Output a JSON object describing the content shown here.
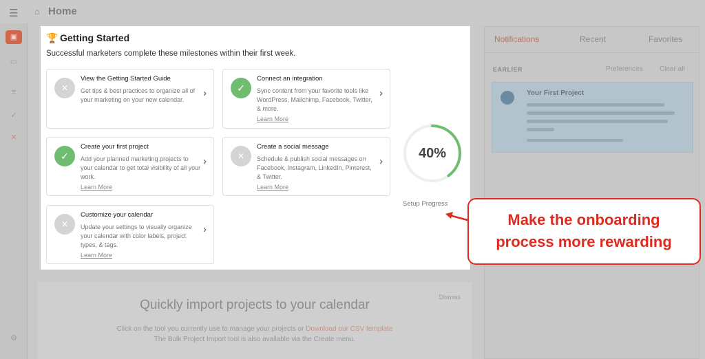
{
  "topbar": {
    "title": "Home"
  },
  "notifications": {
    "tabs": [
      "Notifications",
      "Recent",
      "Favorites"
    ],
    "section": "EARLIER",
    "preferences": "Preferences",
    "clear_all": "Clear all",
    "item_title": "Your First Project"
  },
  "getting_started": {
    "title": "Getting Started",
    "subtitle": "Successful marketers complete these milestones within their first week.",
    "tasks": [
      {
        "title": "View the Getting Started Guide",
        "desc": "Get tips & best practices to organize all of your marketing on your new calendar.",
        "link": "",
        "done": false
      },
      {
        "title": "Connect an integration",
        "desc": "Sync content from your favorite tools like WordPress, Mailchimp, Facebook, Twitter, & more.",
        "link": "Learn More",
        "done": true
      },
      {
        "title": "Create your first project",
        "desc": "Add your planned marketing projects to your calendar to get total visibility of all your work.",
        "link": "Learn More",
        "done": true
      },
      {
        "title": "Create a social message",
        "desc": "Schedule & publish social messages on Facebook, Instagram, LinkedIn, Pinterest, & Twitter.",
        "link": "Learn More",
        "done": false
      },
      {
        "title": "Customize your calendar",
        "desc": "Update your settings to visually organize your calendar with color labels, project types, & tags.",
        "link": "Learn More",
        "done": false
      }
    ],
    "progress_value": 40,
    "progress_text": "40%",
    "progress_label": "Setup Progress"
  },
  "import": {
    "title": "Quickly import projects to your calendar",
    "line1": "Click on the tool you currently use to manage your projects or",
    "line1_link": "Download our CSV template",
    "line2": "The Bulk Project Import tool is also available via the Create menu.",
    "dismiss": "Dismiss"
  },
  "annotation": {
    "line1": "Make the onboarding",
    "line2": "process more rewarding"
  },
  "colors": {
    "accent": "#e02a1f",
    "done": "#70bd72",
    "pending": "#d4d4d4"
  },
  "icons": {
    "check": "check-icon",
    "close": "x-icon",
    "chevron": "chevron-right-icon",
    "trophy": "trophy-icon"
  }
}
